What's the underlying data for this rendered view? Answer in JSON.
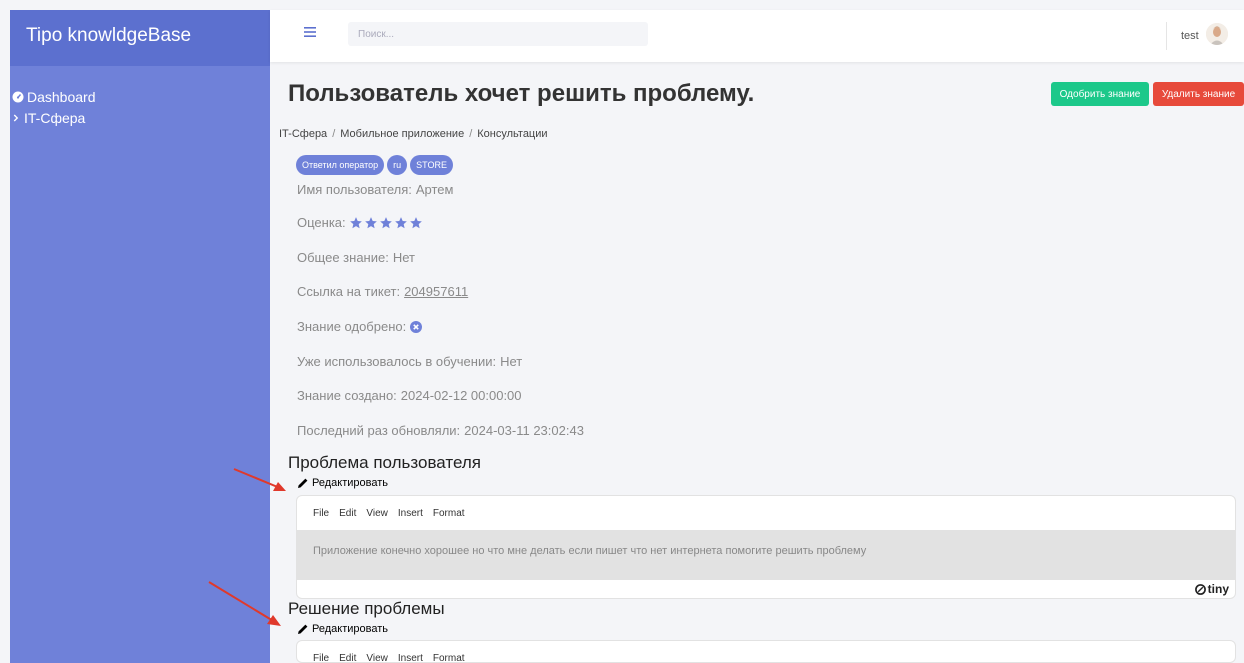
{
  "app": {
    "brand": "Tipo knowldgeBase"
  },
  "sidebar": {
    "items": [
      {
        "label": "Dashboard",
        "icon": "tachometer-icon"
      },
      {
        "label": "IT-Сфера",
        "icon": "chevron-right-icon"
      }
    ]
  },
  "header": {
    "search_placeholder": "Поиск...",
    "user_name": "test"
  },
  "page": {
    "title": "Пользователь хочет решить проблему.",
    "approve_label": "Одобрить знание",
    "delete_label": "Удалить знание",
    "breadcrumb": [
      "IT-Сфера",
      "Мобильное приложение",
      "Консультации"
    ],
    "badges": [
      "Ответил оператор",
      "ru",
      "STORE"
    ]
  },
  "details": {
    "user_label": "Имя пользователя:",
    "user_value": "Артем",
    "rating_label": "Оценка:",
    "rating_value": 5,
    "rating_max": 5,
    "general_label": "Общее знание:",
    "general_value": "Нет",
    "ticket_label": "Ссылка на тикет:",
    "ticket_value": "204957611",
    "approved_label": "Знание одобрено:",
    "approved_value": false,
    "training_label": "Уже использовалось в обучении:",
    "training_value": "Нет",
    "created_label": "Знание создано:",
    "created_value": "2024-02-12 00:00:00",
    "updated_label": "Последний раз обновляли:",
    "updated_value": "2024-03-11 23:02:43"
  },
  "sections": {
    "problem_title": "Проблема пользователя",
    "solution_title": "Решение проблемы",
    "edit_label": "Редактировать",
    "problem_text": "Приложение конечно хорошее но что мне делать если пишет что нет интернета помогите решить проблему"
  },
  "editor": {
    "menu": [
      "File",
      "Edit",
      "View",
      "Insert",
      "Format"
    ],
    "brand": "tiny"
  },
  "colors": {
    "sidebar": "#6f81d9",
    "brand_bar": "#5c70cf",
    "approve": "#1cc88a",
    "delete": "#e74a3b",
    "arrow": "#e0392b"
  }
}
